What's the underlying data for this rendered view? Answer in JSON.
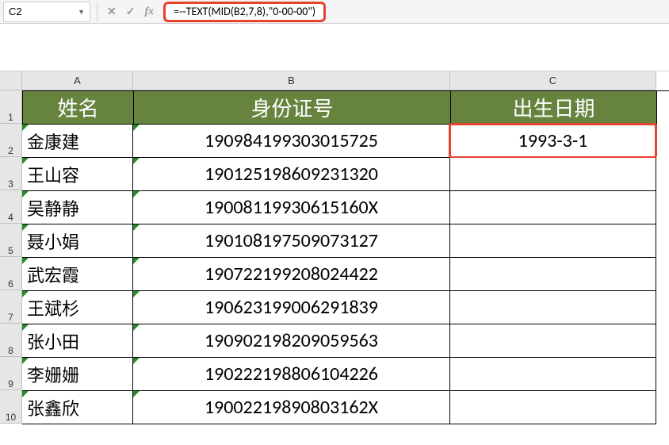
{
  "formula_bar": {
    "cell_ref": "C2",
    "formula": "=--TEXT(MID(B2,7,8),\"0-00-00\")"
  },
  "columns": {
    "A": "A",
    "B": "B",
    "C": "C"
  },
  "row_labels": [
    "1",
    "2",
    "3",
    "4",
    "5",
    "6",
    "7",
    "8",
    "9",
    "10"
  ],
  "headers": {
    "A": "姓名",
    "B": "身份证号",
    "C": "出生日期"
  },
  "rows": [
    {
      "A": "金康建",
      "B": "190984199303015725",
      "C": "1993-3-1"
    },
    {
      "A": "王山容",
      "B": "190125198609231320",
      "C": ""
    },
    {
      "A": "吴静静",
      "B": "19008119930615160X",
      "C": ""
    },
    {
      "A": "聂小娟",
      "B": "190108197509073127",
      "C": ""
    },
    {
      "A": "武宏霞",
      "B": "190722199208024422",
      "C": ""
    },
    {
      "A": "王斌杉",
      "B": "190623199006291839",
      "C": ""
    },
    {
      "A": "张小田",
      "B": "190902198209059563",
      "C": ""
    },
    {
      "A": "李姗姗",
      "B": "190222198806104226",
      "C": ""
    },
    {
      "A": "张鑫欣",
      "B": "19002219890803162X",
      "C": ""
    }
  ]
}
